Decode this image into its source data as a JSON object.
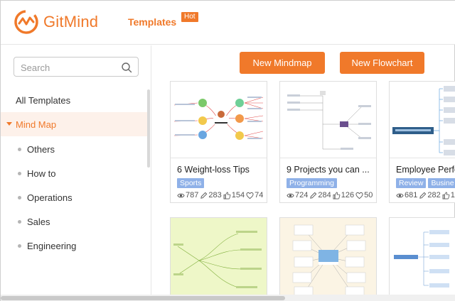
{
  "header": {
    "brand": "GitMind",
    "nav_templates": "Templates",
    "hot_badge": "Hot",
    "brand_color": "#f0792a"
  },
  "sidebar": {
    "search_placeholder": "Search",
    "all_templates": "All Templates",
    "active_category": "Mind Map",
    "sub_items": [
      "Others",
      "How to",
      "Operations",
      "Sales",
      "Engineering"
    ]
  },
  "toolbar": {
    "new_mindmap": "New Mindmap",
    "new_flowchart": "New Flowchart"
  },
  "cards": [
    {
      "title": "6 Weight-loss Tips",
      "tags": [
        "Sports"
      ],
      "views": "787",
      "edits": "283",
      "likes": "154",
      "favs": "74"
    },
    {
      "title": "9 Projects you can ...",
      "tags": [
        "Programming"
      ],
      "views": "724",
      "edits": "284",
      "likes": "126",
      "favs": "50"
    },
    {
      "title": "Employee Perfo",
      "tags": [
        "Review",
        "Busine"
      ],
      "views": "681",
      "edits": "282",
      "likes": "1",
      "favs": ""
    }
  ],
  "icons": {
    "search": "search-icon",
    "views": "eye-icon",
    "edits": "pencil-icon",
    "likes": "thumbs-up-icon",
    "favs": "heart-icon"
  }
}
